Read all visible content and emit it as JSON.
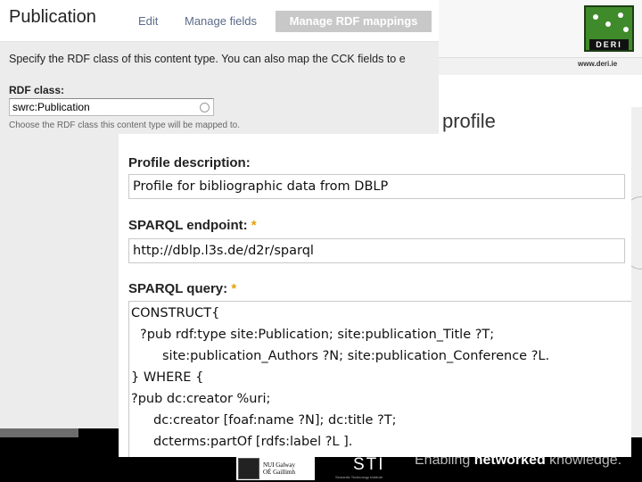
{
  "back_panel": {
    "title": "Publication",
    "tabs": [
      "Edit",
      "Manage fields",
      "Manage RDF mappings"
    ],
    "description": "Specify the RDF class of this content type. You can also map the CCK fields to e",
    "rdf_class_label": "RDF class:",
    "rdf_class_value": "swrc:Publication",
    "rdf_class_help": "Choose the RDF class this content type will be mapped to."
  },
  "header_brand": {
    "logo_text": "DERI",
    "url": "www.deri.ie"
  },
  "front_panel": {
    "heading_word": "profile",
    "profile_description_label": "Profile description:",
    "profile_description_value": "Profile for bibliographic data from DBLP",
    "sparql_endpoint_label": "SPARQL endpoint:",
    "sparql_endpoint_value": "http://dblp.l3s.de/d2r/sparql",
    "sparql_query_label": "SPARQL query:",
    "required_marker": "*",
    "query_lines": [
      "CONSTRUCT{",
      "?pub rdf:type site:Publication; site:publication_Title ?T;",
      "site:publication_Authors ?N; site:publication_Conference ?L.",
      "} WHERE {",
      "?pub dc:creator %uri;",
      "dc:creator [foaf:name ?N]; dc:title ?T;",
      "dcterms:partOf [rdfs:label ?L ]."
    ]
  },
  "footer": {
    "nui_logo_text": [
      "NUI Galway",
      "OÉ Gaillimh"
    ],
    "sti_logo_text": "STI",
    "sti_small_text": "Semantic Technology Institute",
    "tagline_prefix": "Enabling ",
    "tagline_bold": "networked",
    "tagline_suffix": " knowledge."
  },
  "colors": {
    "active_tab_bg": "#c8c8c8",
    "required": "#e8a000",
    "deri_green": "#3f8a2a"
  }
}
